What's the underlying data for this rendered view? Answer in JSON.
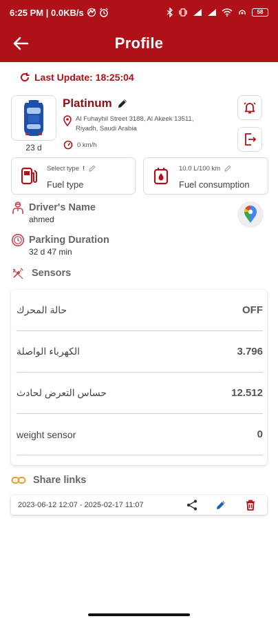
{
  "colors": {
    "primary": "#b01018",
    "dark_red": "#8a0e15",
    "link_gold": "#e0a32d",
    "edit_blue": "#1f5fb5"
  },
  "status_bar": {
    "time_speed": "6:25 PM | 0.0KB/s",
    "battery": "58"
  },
  "app_bar": {
    "title": "Profile"
  },
  "last_update": "Last Update: 18:25:04",
  "vehicle": {
    "name": "Platinum",
    "age": "23 d",
    "address_line1": "Al Fuhayhil Street 3188, Al Akeek 13511,",
    "address_line2": "Riyadh, Saudi Arabia",
    "speed": "0 km/h"
  },
  "fuel_type_card": {
    "small": "Select type",
    "big": "Fuel type"
  },
  "fuel_consumption_card": {
    "small": "10.0 L/100 km",
    "big": "Fuel consumption"
  },
  "driver": {
    "label": "Driver's Name",
    "value": "ahmed"
  },
  "parking": {
    "label": "Parking Duration",
    "value": "32 d 47 min"
  },
  "sensors": {
    "label": "Sensors",
    "rows": [
      {
        "name": "حالة المحرك",
        "value": "OFF"
      },
      {
        "name": "الكهرباء الواصلة",
        "value": "3.796"
      },
      {
        "name": "حساس التعرض لحادث",
        "value": "12.512"
      },
      {
        "name": "weight sensor",
        "value": "0"
      }
    ]
  },
  "share_links": {
    "label": "Share links",
    "items": [
      {
        "dates": "2023-06-12 12:07 - 2025-02-17 11:07"
      }
    ]
  }
}
